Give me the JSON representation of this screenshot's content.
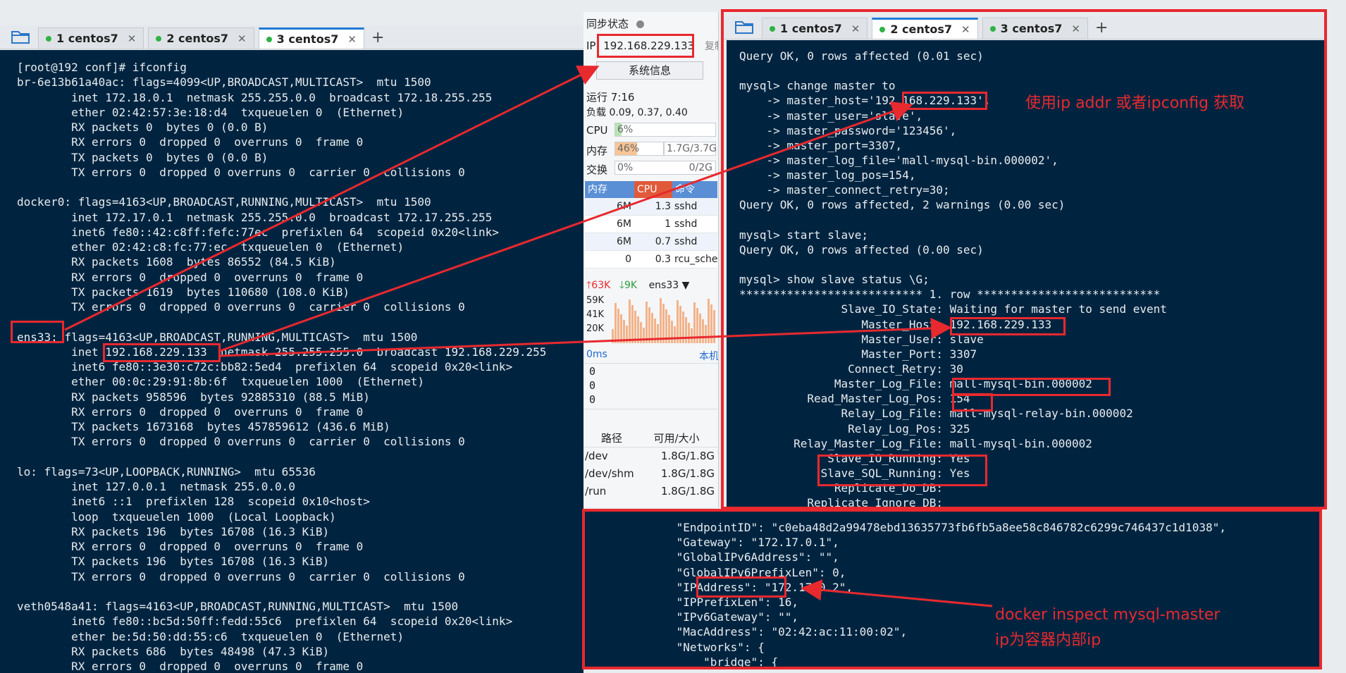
{
  "left_tabs": {
    "folder_icon": "folder-icon",
    "tabs": [
      {
        "label": "1 centos7",
        "active": false
      },
      {
        "label": "2 centos7",
        "active": false
      },
      {
        "label": "3 centos7",
        "active": true
      }
    ],
    "plus": "+"
  },
  "right_tabs": {
    "folder_icon": "folder-icon",
    "tabs": [
      {
        "label": "1 centos7",
        "active": false
      },
      {
        "label": "2 centos7",
        "active": true
      },
      {
        "label": "3 centos7",
        "active": false
      }
    ],
    "plus": "+"
  },
  "left_terminal": {
    "lines": [
      "[root@192 conf]# ifconfig",
      "br-6e13b61a40ac: flags=4099<UP,BROADCAST,MULTICAST>  mtu 1500",
      "        inet 172.18.0.1  netmask 255.255.0.0  broadcast 172.18.255.255",
      "        ether 02:42:57:3e:18:d4  txqueuelen 0  (Ethernet)",
      "        RX packets 0  bytes 0 (0.0 B)",
      "        RX errors 0  dropped 0  overruns 0  frame 0",
      "        TX packets 0  bytes 0 (0.0 B)",
      "        TX errors 0  dropped 0 overruns 0  carrier 0  collisions 0",
      "",
      "docker0: flags=4163<UP,BROADCAST,RUNNING,MULTICAST>  mtu 1500",
      "        inet 172.17.0.1  netmask 255.255.0.0  broadcast 172.17.255.255",
      "        inet6 fe80::42:c8ff:fefc:77ec  prefixlen 64  scopeid 0x20<link>",
      "        ether 02:42:c8:fc:77:ec  txqueuelen 0  (Ethernet)",
      "        RX packets 1608  bytes 86552 (84.5 KiB)",
      "        RX errors 0  dropped 0  overruns 0  frame 0",
      "        TX packets 1619  bytes 110680 (108.0 KiB)",
      "        TX errors 0  dropped 0 overruns 0  carrier 0  collisions 0",
      "",
      "ens33: flags=4163<UP,BROADCAST,RUNNING,MULTICAST>  mtu 1500",
      "        inet 192.168.229.133  netmask 255.255.255.0  broadcast 192.168.229.255",
      "        inet6 fe80::3e30:c72c:bb82:5ed4  prefixlen 64  scopeid 0x20<link>",
      "        ether 00:0c:29:91:8b:6f  txqueuelen 1000  (Ethernet)",
      "        RX packets 958596  bytes 92885310 (88.5 MiB)",
      "        RX errors 0  dropped 0  overruns 0  frame 0",
      "        TX packets 1673168  bytes 457859612 (436.6 MiB)",
      "        TX errors 0  dropped 0 overruns 0  carrier 0  collisions 0",
      "",
      "lo: flags=73<UP,LOOPBACK,RUNNING>  mtu 65536",
      "        inet 127.0.0.1  netmask 255.0.0.0",
      "        inet6 ::1  prefixlen 128  scopeid 0x10<host>",
      "        loop  txqueuelen 1000  (Local Loopback)",
      "        RX packets 196  bytes 16708 (16.3 KiB)",
      "        RX errors 0  dropped 0  overruns 0  frame 0",
      "        TX packets 196  bytes 16708 (16.3 KiB)",
      "        TX errors 0  dropped 0 overruns 0  carrier 0  collisions 0",
      "",
      "veth0548a41: flags=4163<UP,BROADCAST,RUNNING,MULTICAST>  mtu 1500",
      "        inet6 fe80::bc5d:50ff:fedd:55c6  prefixlen 64  scopeid 0x20<link>",
      "        ether be:5d:50:dd:55:c6  txqueuelen 0  (Ethernet)",
      "        RX packets 686  bytes 48498 (47.3 KiB)",
      "        RX errors 0  dropped 0  overruns 0  frame 0"
    ]
  },
  "status_panel": {
    "sync_label": "同步状态",
    "ip_label": "IP",
    "ip_value": "192.168.229.133",
    "copy_label": "复制",
    "sysinfo_button": "系统信息",
    "uptime": "运行 7:16",
    "load": "负载 0.09, 0.37, 0.40",
    "cpu": {
      "label": "CPU",
      "value": "6%",
      "fraction": 0.06
    },
    "mem": {
      "label": "内存",
      "value": "46%",
      "fraction": 0.46,
      "size": "1.7G/3.7G"
    },
    "swap": {
      "label": "交换",
      "value": "0%",
      "fraction": 0.0,
      "size": "0/2G"
    },
    "proc_headers": [
      "内存",
      "CPU",
      "命令"
    ],
    "processes": [
      {
        "mem": "6M",
        "cpu": "1.3",
        "cmd": "sshd"
      },
      {
        "mem": "6M",
        "cpu": "1",
        "cmd": "sshd"
      },
      {
        "mem": "6M",
        "cpu": "0.7",
        "cmd": "sshd"
      },
      {
        "mem": "0",
        "cpu": "0.3",
        "cmd": "rcu_sche"
      }
    ],
    "net": {
      "up": "63K",
      "down": "9K",
      "iface": "ens33",
      "scale": [
        "59K",
        "41K",
        "20K"
      ]
    },
    "ping": {
      "latency": "0ms",
      "host": "本机",
      "values": [
        "0",
        "0",
        "0"
      ]
    },
    "disk_headers": [
      "路径",
      "可用/大小"
    ],
    "disks": [
      {
        "path": "/dev",
        "size": "1.8G/1.8G"
      },
      {
        "path": "/dev/shm",
        "size": "1.8G/1.8G"
      },
      {
        "path": "/run",
        "size": "1.8G/1.8G"
      }
    ]
  },
  "right_terminal": {
    "lines": [
      "Query OK, 0 rows affected (0.01 sec)",
      "",
      "mysql> change master to",
      "    -> master_host='192.168.229.133',",
      "    -> master_user='slave',",
      "    -> master_password='123456',",
      "    -> master_port=3307,",
      "    -> master_log_file='mall-mysql-bin.000002',",
      "    -> master_log_pos=154,",
      "    -> master_connect_retry=30;",
      "Query OK, 0 rows affected, 2 warnings (0.00 sec)",
      "",
      "mysql> start slave;",
      "Query OK, 0 rows affected (0.00 sec)",
      "",
      "mysql> show slave status \\G;",
      "*************************** 1. row ***************************",
      "               Slave_IO_State: Waiting for master to send event",
      "                  Master_Host: 192.168.229.133",
      "                  Master_User: slave",
      "                  Master_Port: 3307",
      "                Connect_Retry: 30",
      "              Master_Log_File: mall-mysql-bin.000002",
      "          Read_Master_Log_Pos: 154",
      "               Relay_Log_File: mall-mysql-relay-bin.000002",
      "                Relay_Log_Pos: 325",
      "        Relay_Master_Log_File: mall-mysql-bin.000002",
      "             Slave_IO_Running: Yes",
      "            Slave_SQL_Running: Yes",
      "              Replicate_Do_DB:",
      "          Replicate_Ignore_DB:"
    ]
  },
  "bottom_terminal": {
    "lines": [
      "            \"EndpointID\": \"c0eba48d2a99478ebd13635773fb6fb5a8ee58c846782c6299c746437c1d1038\",",
      "            \"Gateway\": \"172.17.0.1\",",
      "            \"GlobalIPv6Address\": \"\",",
      "            \"GlobalIPv6PrefixLen\": 0,",
      "            \"IPAddress\": \"172.17.0.2\",",
      "            \"IPPrefixLen\": 16,",
      "            \"IPv6Gateway\": \"\",",
      "            \"MacAddress\": \"02:42:ac:11:00:02\",",
      "            \"Networks\": {",
      "                \"bridge\": {"
    ]
  },
  "annotations": {
    "note_ip": "使用ip addr 或者ipconfig 获取",
    "note_docker_1": "docker inspect mysql-master",
    "note_docker_2": "ip为容器内部ip"
  },
  "colors": {
    "terminal_bg": "#002440",
    "terminal_fg": "#e8ecef",
    "annotation_red": "#e8292e",
    "tab_active_border": "#1f7ad6",
    "session_dot": "#2fb344",
    "cpu_fill": "#b8e4b4",
    "mem_fill": "#f8c596",
    "proc_header_bg": "#5a8fd6",
    "proc_header_cpu": "#e05a3a"
  }
}
